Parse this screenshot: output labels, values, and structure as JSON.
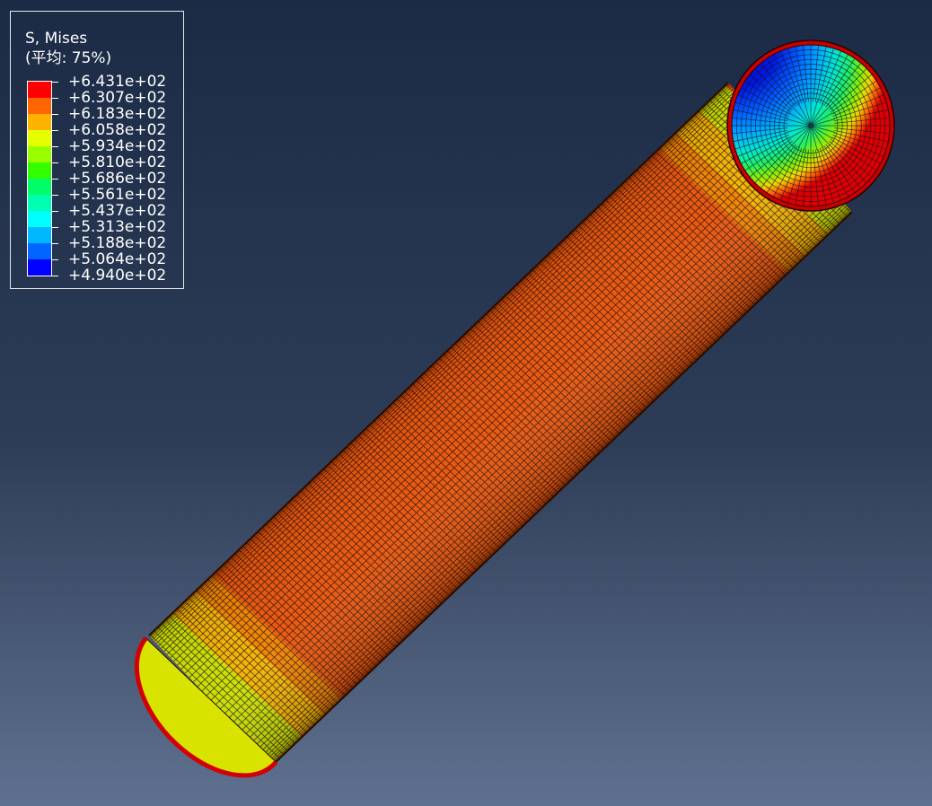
{
  "legend": {
    "title": "S, Mises",
    "subtitle": "(平均: 75%)",
    "labels": [
      "+6.431e+02",
      "+6.307e+02",
      "+6.183e+02",
      "+6.058e+02",
      "+5.934e+02",
      "+5.810e+02",
      "+5.686e+02",
      "+5.561e+02",
      "+5.437e+02",
      "+5.313e+02",
      "+5.188e+02",
      "+5.064e+02",
      "+4.940e+02"
    ],
    "colors": [
      "#ff0000",
      "#ff6600",
      "#ffb300",
      "#e6ff00",
      "#99ff00",
      "#33ff00",
      "#00ff66",
      "#00ffb0",
      "#00ffff",
      "#00b8ff",
      "#0066ff",
      "#0000ff"
    ]
  },
  "colors": {
    "background_top": "#1b2b45",
    "background_bottom": "#5c6e8a",
    "tube_body": "#e8560c",
    "mesh_line": "#1a0a00",
    "end_band": "#d4e000",
    "rim": "#d40000",
    "core": "#0014d6"
  }
}
